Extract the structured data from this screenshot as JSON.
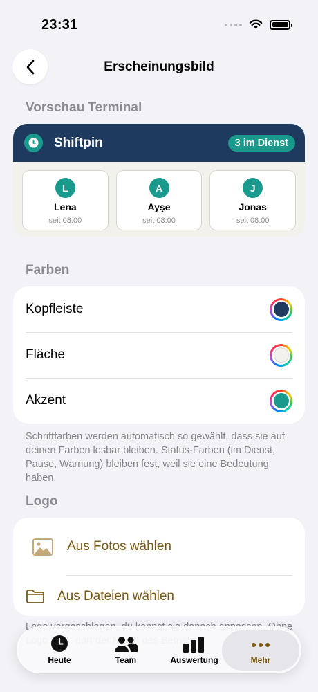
{
  "status_bar": {
    "time": "23:31"
  },
  "nav": {
    "title": "Erscheinungsbild"
  },
  "preview": {
    "section_title": "Vorschau Terminal",
    "brand": "Shiftpin",
    "badge": "3 im Dienst",
    "header_color": "#1e3a5f",
    "surface_color": "#f2f1ec",
    "accent_color": "#1a9a8c",
    "people": [
      {
        "initial": "L",
        "name": "Lena",
        "since": "seit 08:00"
      },
      {
        "initial": "A",
        "name": "Ayşe",
        "since": "seit 08:00"
      },
      {
        "initial": "J",
        "name": "Jonas",
        "since": "seit 08:00"
      }
    ]
  },
  "colors": {
    "section_title": "Farben",
    "rows": [
      {
        "label": "Kopfleiste",
        "color": "#1e3a5f"
      },
      {
        "label": "Fläche",
        "color": "#f2f1ec"
      },
      {
        "label": "Akzent",
        "color": "#1a9a8c"
      }
    ],
    "footnote": "Schriftfarben werden automatisch so gewählt, dass sie auf deinen Farben lesbar bleiben. Status-Farben (im Dienst, Pause, Warnung) bleiben fest, weil sie eine Bedeutung haben."
  },
  "logo": {
    "section_title": "Logo",
    "from_photos": "Aus Fotos wählen",
    "from_files": "Aus Dateien wählen",
    "footnote_partial": "Logo vorgeschlagen, du kannst sie danach anpassen. Ohne Logo steht dort der Name des Betriebs."
  },
  "tab_bar": {
    "tabs": [
      {
        "label": "Heute",
        "icon": "clock-icon"
      },
      {
        "label": "Team",
        "icon": "people-icon"
      },
      {
        "label": "Auswertung",
        "icon": "chart-icon"
      },
      {
        "label": "Mehr",
        "icon": "more-icon",
        "active": true
      }
    ]
  }
}
